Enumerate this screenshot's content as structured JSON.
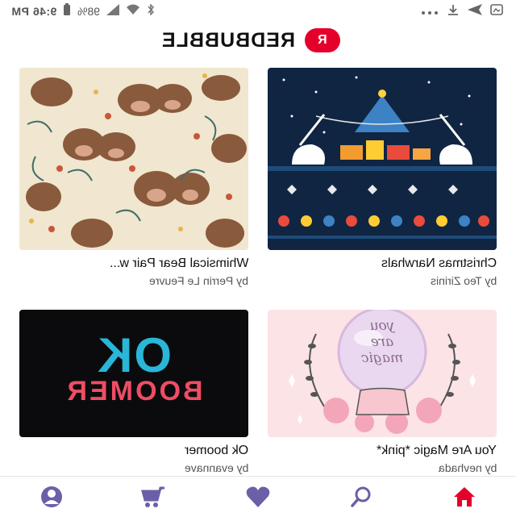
{
  "status_bar": {
    "time": "9:46 PM",
    "battery": "98%",
    "icons": [
      "dots-icon",
      "download-icon",
      "send-icon",
      "bluetooth-icon",
      "wifi-icon",
      "signal-icon",
      "battery-icon"
    ]
  },
  "brand": {
    "name": "REDBUBBLE",
    "badge": "R",
    "accent": "#e4002b"
  },
  "products": [
    {
      "title": "Whimsical Bear Pair w...",
      "artist": "by Perrin Le Feuvre"
    },
    {
      "title": "Christmas Narwhals",
      "artist": "by Teo Zirinis"
    },
    {
      "title": "Ok boomer",
      "artist": "by evannave"
    },
    {
      "title": "You Are Magic *pink*",
      "artist": "by nevhada"
    }
  ],
  "artwork_text": {
    "ok": "OK",
    "boomer": "BOOMER",
    "magic_1": "you",
    "magic_2": "are",
    "magic_3": "magic"
  },
  "bottom_nav": {
    "items": [
      "account-icon",
      "cart-icon",
      "heart-icon",
      "search-icon",
      "home-icon"
    ],
    "color": "#6b5fa8",
    "active_color": "#e4002b"
  }
}
